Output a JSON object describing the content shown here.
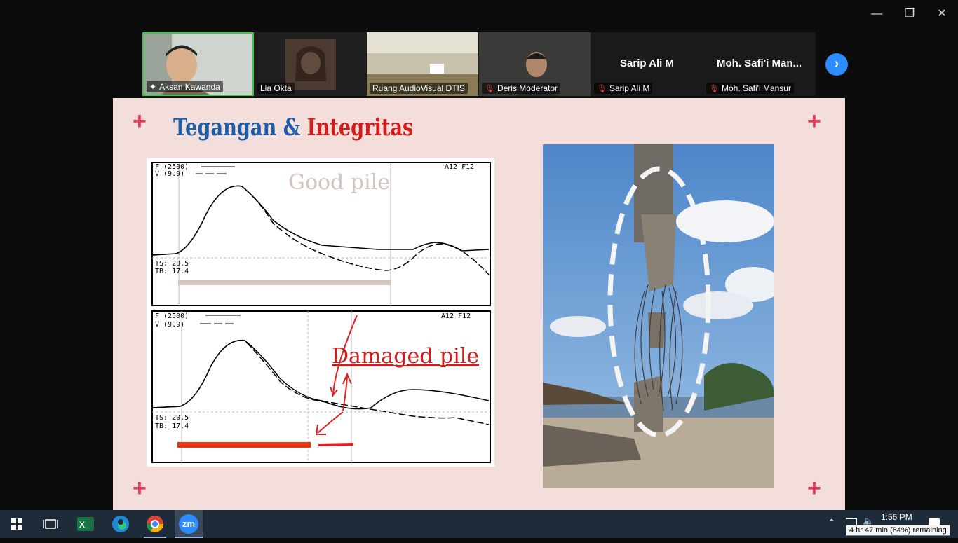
{
  "window": {
    "minimize_icon": "minimize-icon",
    "restore_icon": "restore-icon",
    "close_icon": "close-icon"
  },
  "participants": [
    {
      "name": "Aksan Kawanda",
      "video": true,
      "active_speaker": true,
      "muted": false
    },
    {
      "name": "Lia Okta",
      "video": true,
      "muted": false
    },
    {
      "name": "Ruang AudioVisual DTIS",
      "video": true,
      "muted": false
    },
    {
      "name": "Deris Moderator",
      "video": true,
      "muted": true
    },
    {
      "name": "Sarip Ali M",
      "display": "Sarip Ali M",
      "video": false,
      "muted": true
    },
    {
      "name": "Moh. Safi'i Mansur",
      "display": "Moh.  Safi'i  Man...",
      "video": false,
      "muted": true
    }
  ],
  "slide": {
    "title_part1": "Tegangan",
    "title_amp": "&",
    "title_part2": "Integritas",
    "accent_color": "#e43b5d",
    "top_panel": {
      "legend_f": "F (2500)",
      "legend_v": "V (9.9)",
      "tag": "A12 F12",
      "ts": "TS: 20.5",
      "tb": "TB: 17.4",
      "label": "Good pile"
    },
    "bottom_panel": {
      "legend_f": "F (2500)",
      "legend_v": "V (9.9)",
      "tag": "A12 F12",
      "ts": "TS: 20.5",
      "tb": "TB: 17.4",
      "label": "Damaged pile"
    }
  },
  "taskbar": {
    "apps": [
      "start-icon",
      "task-view-icon",
      "excel-icon",
      "edge-icon",
      "chrome-icon",
      "zoom-icon"
    ],
    "zoom_label": "zm",
    "time": "1:56 PM",
    "battery_tooltip": "4 hr 47 min (84%) remaining"
  }
}
